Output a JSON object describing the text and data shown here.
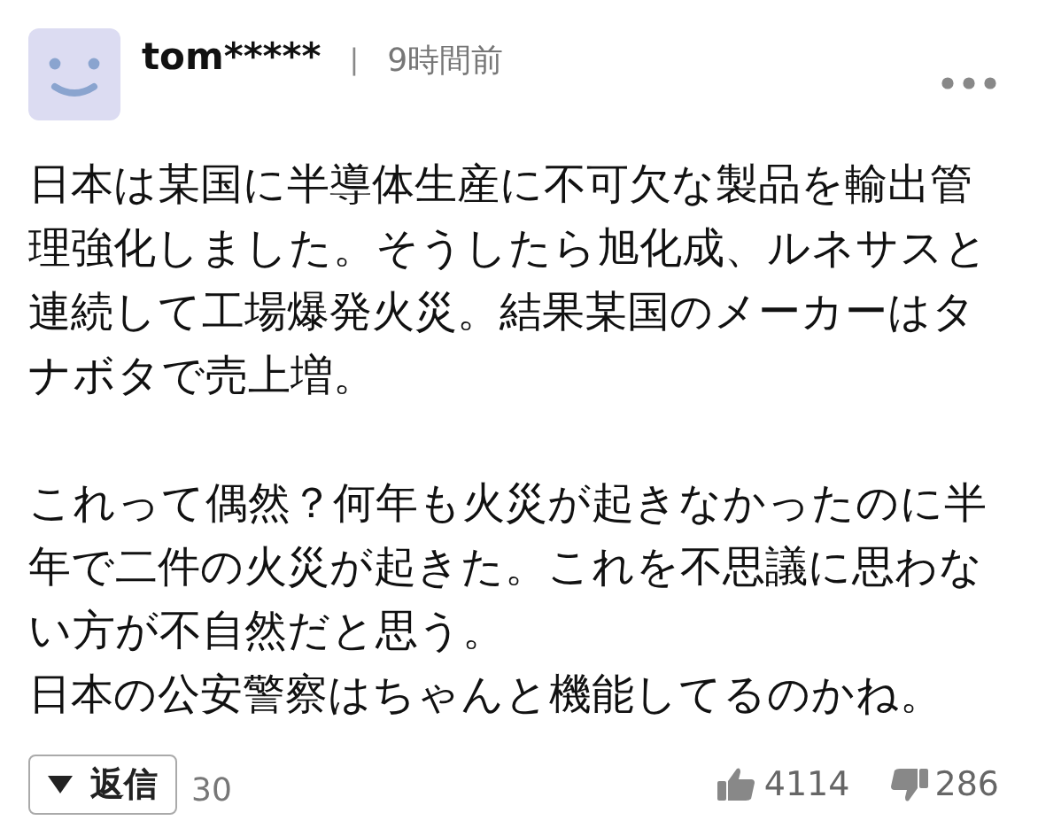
{
  "comment": {
    "user": "tom*****",
    "separator": "|",
    "time": "9時間前",
    "blocks": [
      [
        "日本は某国に半導体生産に不可欠な製品を輸出管理強化しました。そうしたら旭化成、ルネサスと連続して工場爆発火災。結果某国のメーカーはタナボタで売上増。"
      ],
      [
        "これって偶然？何年も火災が起きなかったのに半年で二件の火災が起きた。これを不思議に思わない方が不自然だと思う。",
        "日本の公安警察はちゃんと機能してるのかね。"
      ]
    ],
    "reply_label": "返信",
    "reply_count": "30",
    "likes": "4114",
    "dislikes": "286"
  }
}
